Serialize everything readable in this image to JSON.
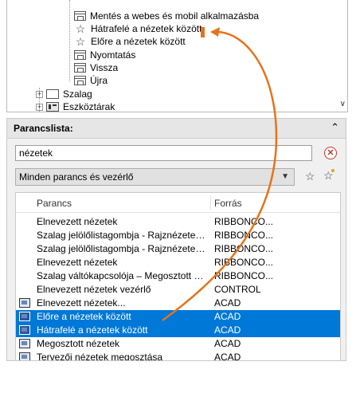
{
  "tree": {
    "items": [
      {
        "label": "Mentés a webes és mobil alkalmazásba",
        "icon": "window-icon"
      },
      {
        "label": "Hátrafelé a nézetek között",
        "icon": "star-icon"
      },
      {
        "label": "Előre a nézetek között",
        "icon": "star-icon"
      },
      {
        "label": "Nyomtatás",
        "icon": "window-icon"
      },
      {
        "label": "Vissza",
        "icon": "window-icon"
      },
      {
        "label": "Újra",
        "icon": "window-icon"
      }
    ],
    "groups": [
      {
        "label": "Szalag",
        "expander": "+",
        "icon": "folder-icon"
      },
      {
        "label": "Eszköztárak",
        "expander": "+",
        "icon": "toolbar-icon"
      }
    ],
    "scroll_down_icon": "chevron-down-icon"
  },
  "command_list": {
    "title": "Parancslista:",
    "collapse_icon": "double-chevron-up-icon",
    "search": {
      "value": "nézetek",
      "clear_icon": "clear-search-icon"
    },
    "filter": {
      "selected": "Minden parancs és vezérlő",
      "arrow_icon": "chevron-down-icon"
    },
    "find_icon": "find-command-icon",
    "new_icon": "new-command-icon",
    "columns": {
      "command": "Parancs",
      "source": "Forrás"
    },
    "rows": [
      {
        "command": "Elnevezett nézetek",
        "source": "RIBBONCO...",
        "icon": "none",
        "selected": false
      },
      {
        "command": "Szalag jelölőlistagombja - Rajznézetek kiv...",
        "source": "RIBBONCO...",
        "icon": "none",
        "selected": false
      },
      {
        "command": "Szalag jelölőlistagombja - Rajznézetek élei...",
        "source": "RIBBONCO...",
        "icon": "none",
        "selected": false
      },
      {
        "command": "Elnevezett nézetek",
        "source": "RIBBONCO...",
        "icon": "none",
        "selected": false
      },
      {
        "command": "Szalag váltókapcsolója – Megosztott nézet...",
        "source": "RIBBONCO...",
        "icon": "none",
        "selected": false
      },
      {
        "command": "Elnevezett nézetek vezérlő",
        "source": "CONTROL",
        "icon": "none",
        "selected": false
      },
      {
        "command": "Elnevezett nézetek...",
        "source": "ACAD",
        "icon": "named-views-icon",
        "selected": false
      },
      {
        "command": "Előre a nézetek között",
        "source": "ACAD",
        "icon": "view-next-icon",
        "selected": true
      },
      {
        "command": "Hátrafelé a nézetek között",
        "source": "ACAD",
        "icon": "view-previous-icon",
        "selected": true
      },
      {
        "command": "Megosztott nézetek",
        "source": "ACAD",
        "icon": "shared-views-icon",
        "selected": false
      },
      {
        "command": "Tervezői nézetek megosztása",
        "source": "ACAD",
        "icon": "share-design-views-icon",
        "selected": false
      }
    ]
  },
  "colors": {
    "selection": "#0078d7",
    "annotation_arrow": "#e5731b"
  }
}
